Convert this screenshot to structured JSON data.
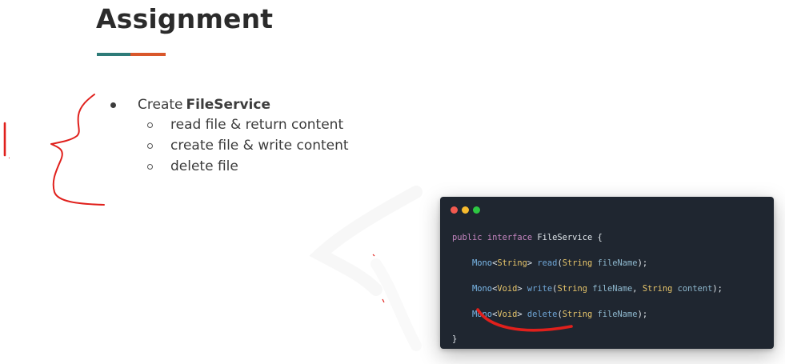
{
  "slide": {
    "title": "Assignment"
  },
  "colors": {
    "title_bar_teal": "#2e7b78",
    "title_bar_orange": "#d9572b",
    "annotation_red": "#e0201c",
    "code_bg": "#1f2630",
    "mac_red": "#f2594f",
    "mac_yellow": "#f7bb2e",
    "mac_green": "#2dc742",
    "code_keyword": "#c586c0",
    "code_type": "#7ab7e8",
    "code_string_type": "#e7c56a",
    "code_method": "#6fa6d6",
    "code_param": "#8fb9cf",
    "code_default": "#dfe5ea"
  },
  "bullets": {
    "main": {
      "prefix": "Create ",
      "strong": "FileService"
    },
    "items": [
      "read file & return content",
      "create file & write content",
      "delete file"
    ]
  },
  "annotation": {
    "number_text": "1."
  },
  "code": {
    "icons": [
      "window-close-dot",
      "window-minimize-dot",
      "window-maximize-dot"
    ],
    "line1": {
      "kw1": "public",
      "kw2": "interface",
      "name": "FileService",
      "brace": "{"
    },
    "line2": {
      "mono": "Mono",
      "lt": "<",
      "generic": "String",
      "gt": ">",
      "method": "read",
      "open": "(",
      "ptype": "String",
      "pname": "fileName",
      "close": ");"
    },
    "line3": {
      "mono": "Mono",
      "lt": "<",
      "generic": "Void",
      "gt": ">",
      "method": "write",
      "open": "(",
      "ptype": "String",
      "pname": "fileName",
      "comma": ", ",
      "ptype2": "String",
      "pname2": "content",
      "close": ");"
    },
    "line4": {
      "mono": "Mono",
      "lt": "<",
      "generic": "Void",
      "gt": ">",
      "method": "delete",
      "open": "(",
      "ptype": "String",
      "pname": "fileName",
      "close": ");"
    },
    "line5": {
      "brace": "}"
    }
  }
}
